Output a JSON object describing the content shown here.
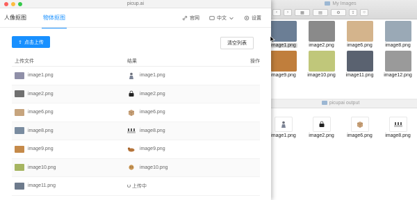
{
  "window": {
    "title": "picup.ai"
  },
  "nav": {
    "tabs": [
      {
        "label": "人像抠图",
        "active": false
      },
      {
        "label": "物体抠图",
        "active": true
      }
    ],
    "website": "官网",
    "language": "中文",
    "settings": "设置"
  },
  "toolbar": {
    "upload_label": "点击上传",
    "clear_label": "清空列表"
  },
  "table": {
    "columns": {
      "file": "上传文件",
      "result": "结果",
      "action": "操作"
    },
    "rows": [
      {
        "file": "image1.png",
        "result": "image1.png",
        "thumb_color": "#8f8fa8",
        "result_icon": "person"
      },
      {
        "file": "image2.png",
        "result": "image2.png",
        "thumb_color": "#707070",
        "result_icon": "bag"
      },
      {
        "file": "image6.png",
        "result": "image6.png",
        "thumb_color": "#c7a57e",
        "result_icon": "box"
      },
      {
        "file": "image8.png",
        "result": "image8.png",
        "thumb_color": "#7a8ca0",
        "result_icon": "chairs"
      },
      {
        "file": "image9.png",
        "result": "image9.png",
        "thumb_color": "#c58a4a",
        "result_icon": "dog"
      },
      {
        "file": "image10.png",
        "result": "image10.png",
        "thumb_color": "#a6b561",
        "result_icon": "puppy"
      },
      {
        "file": "image11.png",
        "result": "",
        "status": "上传中",
        "thumb_color": "#6d7a8c",
        "result_icon": "loading"
      }
    ]
  },
  "finder_top": {
    "title": "My Images",
    "files": [
      {
        "label": "image1.png",
        "color": "#6b7e95"
      },
      {
        "label": "image2.png",
        "color": "#8a8a8a"
      },
      {
        "label": "image6.png",
        "color": "#d4b48c"
      },
      {
        "label": "image8.png",
        "color": "#9aa9b6"
      },
      {
        "label": "image9.png",
        "color": "#c07e3c"
      },
      {
        "label": "image10.png",
        "color": "#c0c77a"
      },
      {
        "label": "image11.png",
        "color": "#5a6270"
      },
      {
        "label": "image12.png",
        "color": "#9a9a9a"
      }
    ]
  },
  "finder_bottom": {
    "title": "picupai output",
    "files": [
      {
        "label": "image1.png",
        "icon": "person"
      },
      {
        "label": "image2.png",
        "icon": "bag"
      },
      {
        "label": "image6.png",
        "icon": "box"
      },
      {
        "label": "image8.png",
        "icon": "chairs"
      }
    ]
  }
}
